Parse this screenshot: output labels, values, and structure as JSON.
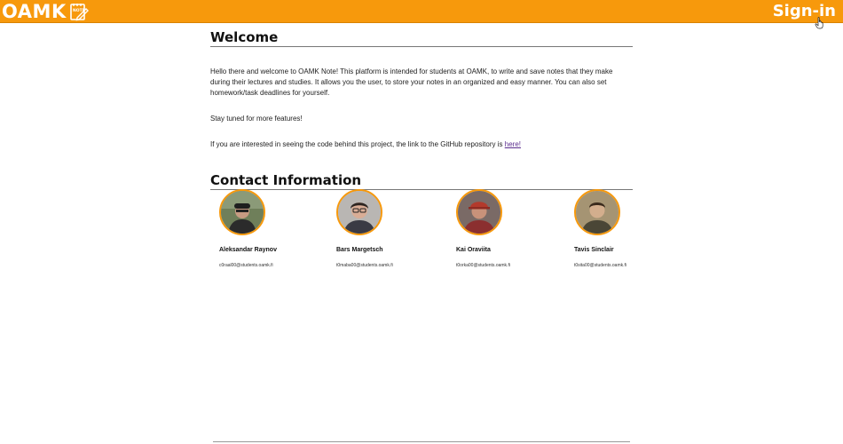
{
  "header": {
    "logo_text": "OAMK",
    "logo_icon": "note-icon",
    "logo_icon_label": "NOTE",
    "signin_label": "Sign-in",
    "background_color": "#f7990c"
  },
  "welcome": {
    "title": "Welcome",
    "intro": "Hello there and welcome to OAMK Note! This platform is intended for students at OAMK, to write and save notes that they make during their lectures and studies. It allows you the user, to store your notes in an organized and easy manner. You can also set homework/task deadlines for yourself.",
    "stay_tuned": "Stay tuned for more features!",
    "github_text": "If you are interested in seeing the code behind this project, the link to the GitHub repository is ",
    "github_link": "here!"
  },
  "contact": {
    "title": "Contact Information",
    "people": [
      {
        "name": "Aleksandar Raynov",
        "email": "c0raal00@students.oamk.fi"
      },
      {
        "name": "Bars Margetsch",
        "email": "t0maba00@students.oamk.fi"
      },
      {
        "name": "Kai Oraviita",
        "email": "t0orka00@students.oamk.fi"
      },
      {
        "name": "Tavis Sinclair",
        "email": "t0sita00@students.oamk.fi"
      }
    ]
  },
  "accent_color": "#f7990c"
}
